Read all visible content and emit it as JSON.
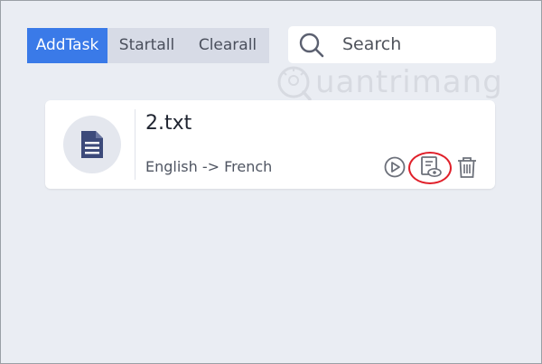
{
  "toolbar": {
    "add_task_label": "AddTask",
    "start_all_label": "Startall",
    "clear_all_label": "Clearall"
  },
  "search": {
    "placeholder": "Search"
  },
  "watermark": {
    "text": "uantrimang"
  },
  "task": {
    "file_name": "2.txt",
    "language_pair": "English -> French"
  },
  "colors": {
    "accent": "#3a7ae8",
    "highlight": "#e0202a",
    "background": "#eaedf3"
  }
}
